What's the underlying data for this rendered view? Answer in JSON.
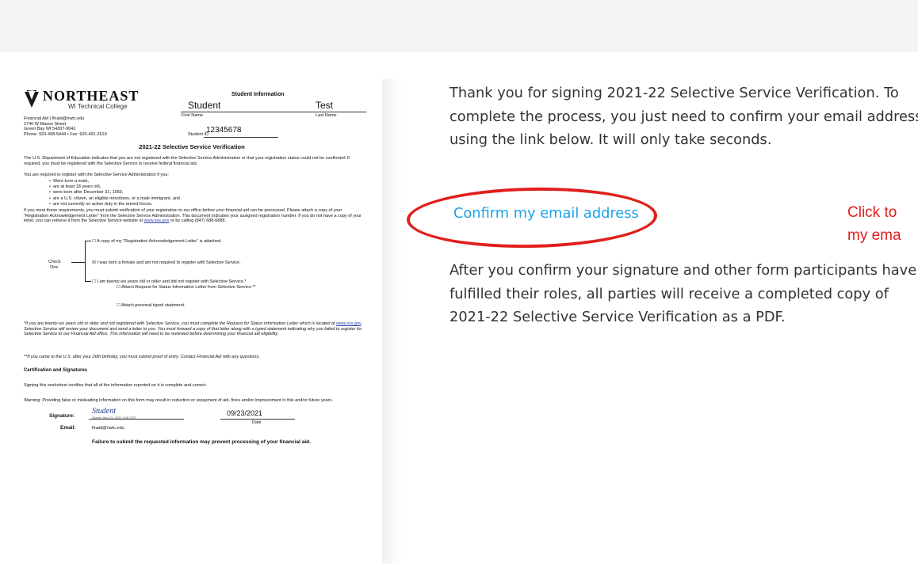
{
  "doc": {
    "logo_name": "NORTHEAST",
    "logo_sub": "WI Technical College",
    "contact_lines": [
      "Financial Aid | finaid@nwtc.edu",
      "2740 W Mason Street",
      "Green Bay WI 54307-9042",
      "Phone: 920-498-5444 • Fax: 920-491-2619"
    ],
    "student_info_title": "Student Information",
    "first_name": "Student",
    "last_name": "Test",
    "first_name_label": "First Name",
    "last_name_label": "Last Name",
    "student_id_label": "Student ID",
    "student_id": "12345678",
    "title": "2021-22 Selective Service Verification",
    "para1": "The U.S. Department of Education indicates that you are not registered with the Selective Service Administration or that your registration status could not be confirmed. If required, you must be registered with the Selective Service to receive federal financial aid.",
    "para2": "You are required to register with the Selective Service Administration if you:",
    "bullets": [
      "Were born a male,",
      "are at least 18 years old,",
      "were born after December 31, 1959,",
      "are a U.S. citizen, an eligible noncitizen, or a male immigrant, and",
      "are not currently on active duty in the armed forces."
    ],
    "para3_a": "If you meet these requirements, you must submit verification of your registration to our office before your financial aid can be processed. Please attach a copy of your \"Registration Acknowledgement Letter\" from the Selective Service Administration. This document indicates your assigned registration number. If you do not have a copy of your letter, you can retrieve it from the Selective Service website at ",
    "para3_link": "www.sss.gov",
    "para3_b": " or by calling (847) 688-6888.",
    "check_label_1": "Check",
    "check_label_2": "One",
    "options": [
      "☐ A copy of my \"Registration Acknowledgement Letter\" is attached.",
      "☒ I was born a female and am not required to register with Selective Service.",
      "☐ I am twenty-six years old or older and did not register with Selective Service.*",
      "☐ Attach Request for Status Information Letter from Selective Service.**",
      "☐ Attach personal typed statement."
    ],
    "note1_a": "*If you are twenty-six years old or older and not registered with Selective Service, you must complete the Request for Status Information Letter which is located at ",
    "note1_link": "www.sss.gov",
    "note1_b": ". Selective Service will review your document and send a letter to you. You must forward a copy of that letter along with a typed statement indicating why you failed to register for Selective Service to our Financial Aid office. This information will need to be reviewed before determining your financial aid eligibility.",
    "note2": "**If you came to the U.S. after your 26th birthday, you must submit proof of entry. Contact Financial Aid with any questions.",
    "cert_heading": "Certification and Signatures",
    "cert_text": "Signing this worksheet certifies that all of the information reported on it is complete and correct.",
    "warning": "Warning: Providing false or misleading information on this form may result in reduction or repayment of aid, fines and/or imprisonment in this and/or future years.",
    "signature_label": "Signature:",
    "signature_value": "Student",
    "signature_small": "Signed Sep 23, 2021 9:08 CDT",
    "date_value": "09/23/2021",
    "date_label": "Date",
    "email_label": "Email:",
    "email_value": "finaid@nwtc.edu",
    "footer_warning": "Failure to submit the requested information may prevent processing of your financial aid."
  },
  "message": {
    "intro": "Thank you for signing 2021-22 Selective Service Verification. To complete the process, you just need to confirm your email address using the link below. It will only take seconds.",
    "confirm_link": "Confirm my email address",
    "outro": "After you confirm your signature and other form participants have fulfilled their roles, all parties will receive a completed copy of 2021-22 Selective Service Verification as a PDF."
  },
  "annotation": {
    "line1": "Click to",
    "line2": "my ema",
    "color": "#e0201c"
  },
  "colors": {
    "link": "#1aa3e8",
    "body_text": "#333333"
  }
}
